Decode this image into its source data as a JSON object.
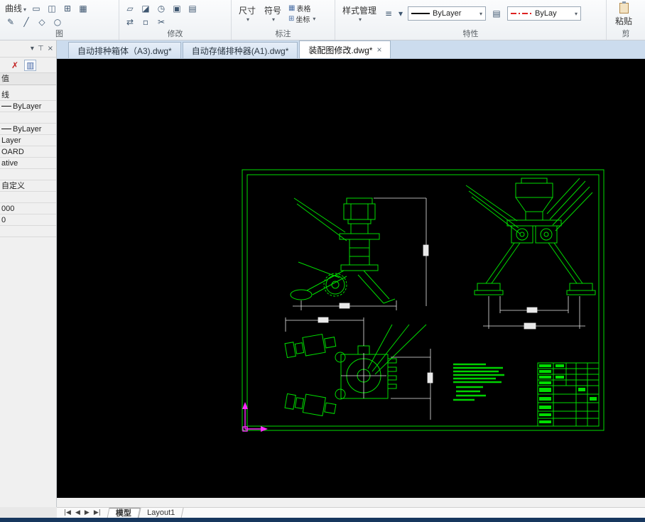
{
  "colors": {
    "cad_green": "#00dd00",
    "cad_white": "#e9e9e9",
    "ucs_magenta": "#ff2bff",
    "status_navy": "#17375e"
  },
  "icons": {
    "caret": "▾",
    "close": "×",
    "pin": "⊤",
    "red_x": "✗",
    "filter": "▥",
    "hamburger": "≡"
  },
  "ribbon": {
    "curve_label": "曲线",
    "groups": {
      "draw": "图",
      "modify": "修改",
      "annotate": "标注",
      "properties": "特性",
      "clipboard": "剪"
    },
    "tool_icons": {
      "draw": [
        "▭",
        "◫",
        "⊞",
        "▦",
        "✎",
        "╱",
        "◇",
        "○"
      ],
      "modify": [
        "▱",
        "◪",
        "◷",
        "▣",
        "▤",
        "⇄",
        "▫",
        "✂"
      ]
    },
    "annotate_items": {
      "dimension": "尺寸",
      "symbol": "符号",
      "table": "表格",
      "coordinate": "坐标"
    },
    "style_manager": "样式管理",
    "layer_combo": "ByLayer",
    "linetype_combo": "ByLay",
    "paste_label": "粘贴"
  },
  "doc_tabs": [
    {
      "label": "自动排种箱体（A3).dwg*"
    },
    {
      "label": "自动存储排种器(A1).dwg*"
    },
    {
      "label": "装配图修改.dwg*"
    }
  ],
  "palette": {
    "header": "值",
    "rows": [
      {
        "t": "线"
      },
      {
        "t": "ByLayer"
      },
      {
        "t": ""
      },
      {
        "t": "ByLayer"
      },
      {
        "t": "Layer"
      },
      {
        "t": "OARD"
      },
      {
        "t": "ative"
      },
      {
        "t": ""
      },
      {
        "t": "自定义"
      },
      {
        "t": ""
      },
      {
        "t": "000"
      },
      {
        "t": "0"
      }
    ]
  },
  "sheet_tabs": {
    "model": "模型",
    "layout": "Layout1"
  }
}
